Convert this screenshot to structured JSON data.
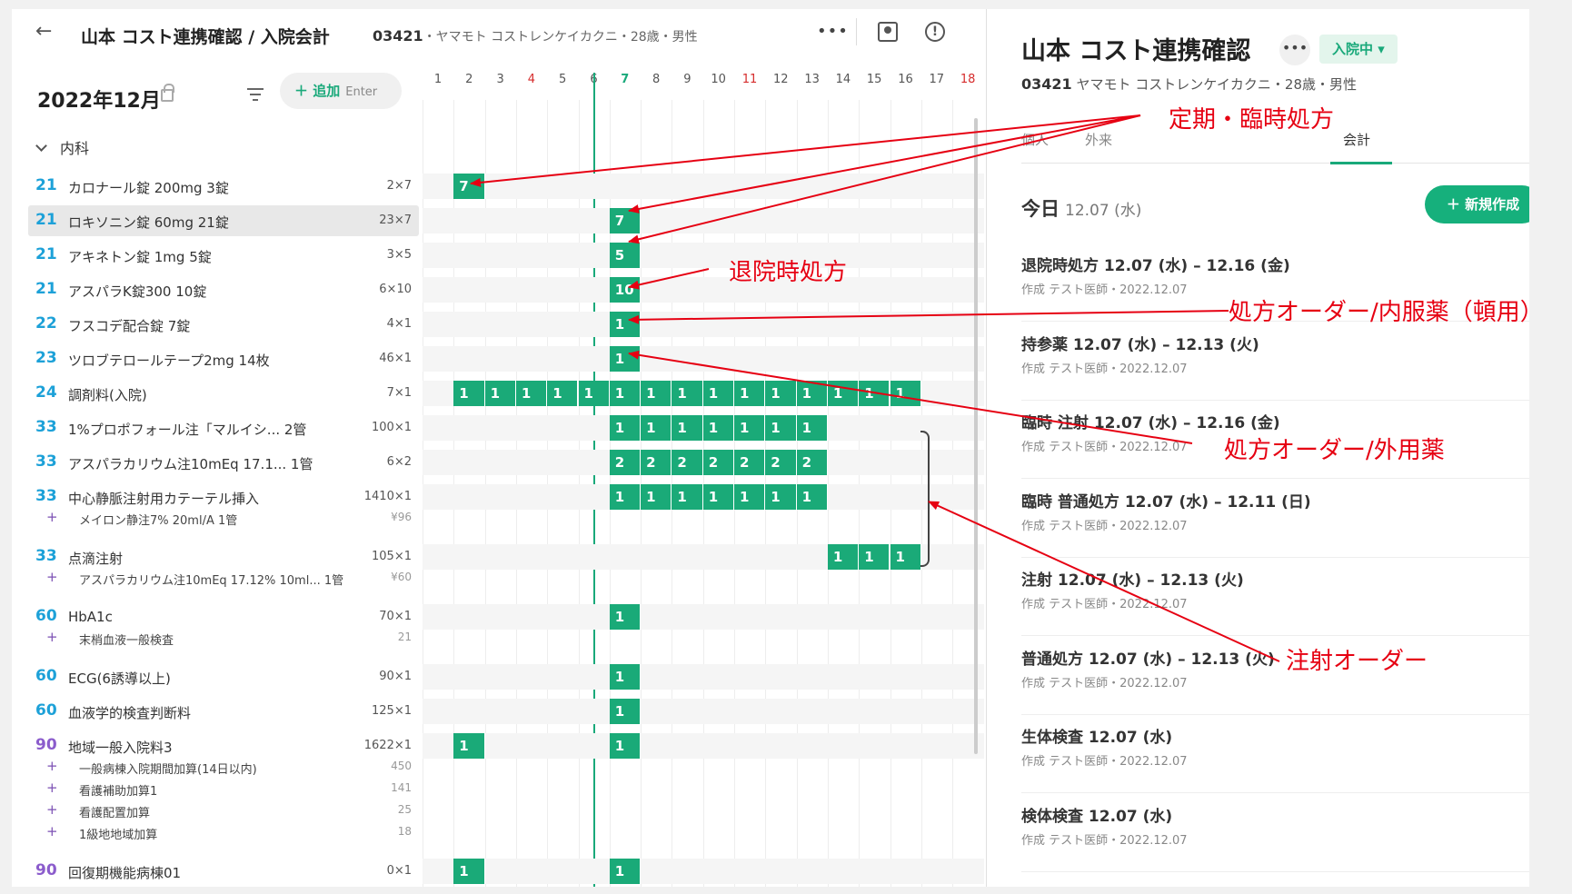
{
  "header": {
    "back_icon": "←",
    "patient_title": "山本 コスト連携確認 / 入院会計",
    "patient_id": "03421",
    "patient_detail": "・ヤマモト コストレンケイカクニ・28歳・男性",
    "more_icon": "•••",
    "alert_icon": "!"
  },
  "toolbar": {
    "month": "2022年12月",
    "add_label": "＋ 追加",
    "add_hint": "Enter"
  },
  "timeline": {
    "days": [
      {
        "d": "1",
        "type": "normal"
      },
      {
        "d": "2",
        "type": "normal"
      },
      {
        "d": "3",
        "type": "normal"
      },
      {
        "d": "4",
        "type": "red"
      },
      {
        "d": "5",
        "type": "normal"
      },
      {
        "d": "6",
        "type": "normal"
      },
      {
        "d": "7",
        "type": "today"
      },
      {
        "d": "8",
        "type": "normal"
      },
      {
        "d": "9",
        "type": "normal"
      },
      {
        "d": "10",
        "type": "normal"
      },
      {
        "d": "11",
        "type": "red"
      },
      {
        "d": "12",
        "type": "normal"
      },
      {
        "d": "13",
        "type": "normal"
      },
      {
        "d": "14",
        "type": "normal"
      },
      {
        "d": "15",
        "type": "normal"
      },
      {
        "d": "16",
        "type": "normal"
      },
      {
        "d": "17",
        "type": "normal"
      },
      {
        "d": "18",
        "type": "red"
      }
    ]
  },
  "section": {
    "label": "内科"
  },
  "rows": [
    {
      "code": "21",
      "color": "blue",
      "name": "カロナール錠 200mg 3錠",
      "qty": "2×7",
      "cells": [
        [
          2,
          "7"
        ]
      ]
    },
    {
      "code": "21",
      "color": "blue",
      "name": "ロキソニン錠 60mg 21錠",
      "qty": "23×7",
      "selected": true,
      "cells": [
        [
          7,
          "7"
        ]
      ]
    },
    {
      "code": "21",
      "color": "blue",
      "name": "アキネトン錠 1mg 5錠",
      "qty": "3×5",
      "cells": [
        [
          7,
          "5"
        ]
      ]
    },
    {
      "code": "21",
      "color": "blue",
      "name": "アスパラK錠300 10錠",
      "qty": "6×10",
      "cells": [
        [
          7,
          "10"
        ]
      ]
    },
    {
      "code": "22",
      "color": "blue",
      "name": "フスコデ配合錠 7錠",
      "qty": "4×1",
      "cells": [
        [
          7,
          "1"
        ]
      ]
    },
    {
      "code": "23",
      "color": "blue",
      "name": "ツロブテロールテープ2mg 14枚",
      "qty": "46×1",
      "cells": [
        [
          7,
          "1"
        ]
      ]
    },
    {
      "code": "24",
      "color": "blue",
      "name": "調剤料(入院)",
      "qty": "7×1",
      "cells": [
        [
          2,
          "1"
        ],
        [
          3,
          "1"
        ],
        [
          4,
          "1"
        ],
        [
          5,
          "1"
        ],
        [
          6,
          "1"
        ],
        [
          7,
          "1"
        ],
        [
          8,
          "1"
        ],
        [
          9,
          "1"
        ],
        [
          10,
          "1"
        ],
        [
          11,
          "1"
        ],
        [
          12,
          "1"
        ],
        [
          13,
          "1"
        ],
        [
          14,
          "1"
        ],
        [
          15,
          "1"
        ],
        [
          16,
          "1"
        ]
      ]
    },
    {
      "code": "33",
      "color": "blue",
      "name": "1%プロポフォール注「マルイシ... 2管",
      "qty": "100×1",
      "cells": [
        [
          7,
          "1"
        ],
        [
          8,
          "1"
        ],
        [
          9,
          "1"
        ],
        [
          10,
          "1"
        ],
        [
          11,
          "1"
        ],
        [
          12,
          "1"
        ],
        [
          13,
          "1"
        ]
      ]
    },
    {
      "code": "33",
      "color": "blue",
      "name": "アスパラカリウム注10mEq 17.1... 1管",
      "qty": "6×2",
      "cells": [
        [
          7,
          "2"
        ],
        [
          8,
          "2"
        ],
        [
          9,
          "2"
        ],
        [
          10,
          "2"
        ],
        [
          11,
          "2"
        ],
        [
          12,
          "2"
        ],
        [
          13,
          "2"
        ]
      ]
    },
    {
      "code": "33",
      "color": "blue",
      "name": "中心静脈注射用カテーテル挿入",
      "qty": "1410×1",
      "cells": [
        [
          7,
          "1"
        ],
        [
          8,
          "1"
        ],
        [
          9,
          "1"
        ],
        [
          10,
          "1"
        ],
        [
          11,
          "1"
        ],
        [
          12,
          "1"
        ],
        [
          13,
          "1"
        ]
      ],
      "subs": [
        {
          "name": "メイロン静注7% 20ml/A 1管",
          "qty": "¥96"
        }
      ]
    },
    {
      "code": "33",
      "color": "blue",
      "name": "点滴注射",
      "qty": "105×1",
      "cells": [
        [
          14,
          "1"
        ],
        [
          15,
          "1"
        ],
        [
          16,
          "1"
        ]
      ],
      "subs": [
        {
          "name": "アスパラカリウム注10mEq 17.12% 10ml... 1管",
          "qty": "¥60"
        }
      ]
    },
    {
      "code": "60",
      "color": "blue",
      "name": "HbA1c",
      "qty": "70×1",
      "cells": [
        [
          7,
          "1"
        ]
      ],
      "subs": [
        {
          "name": "末梢血液一般検査",
          "qty": "21"
        }
      ]
    },
    {
      "code": "60",
      "color": "blue",
      "name": "ECG(6誘導以上)",
      "qty": "90×1",
      "cells": [
        [
          7,
          "1"
        ]
      ]
    },
    {
      "code": "60",
      "color": "blue",
      "name": "血液学的検査判断料",
      "qty": "125×1",
      "cells": [
        [
          7,
          "1"
        ]
      ]
    },
    {
      "code": "90",
      "color": "purple",
      "name": "地域一般入院料3",
      "qty": "1622×1",
      "cells": [
        [
          2,
          "1"
        ],
        [
          7,
          "1"
        ]
      ],
      "subs": [
        {
          "name": "一般病棟入院期間加算(14日以内)",
          "qty": "450"
        },
        {
          "name": "看護補助加算1",
          "qty": "141"
        },
        {
          "name": "看護配置加算",
          "qty": "25"
        },
        {
          "name": "1級地地域加算",
          "qty": "18"
        }
      ]
    },
    {
      "code": "90",
      "color": "purple",
      "name": "回復期機能病棟01",
      "qty": "0×1",
      "cells": [
        [
          2,
          "1"
        ],
        [
          7,
          "1"
        ]
      ]
    }
  ],
  "right": {
    "title": "山本 コスト連携確認",
    "more_icon": "•••",
    "status": "入院中 ▾",
    "info_id": "03421",
    "info_detail": "ヤマモト コストレンケイカクニ・28歳・男性",
    "tabs": [
      "個人",
      "外来",
      "会計"
    ],
    "today_label": "今日",
    "today_date": "12.07 (水)",
    "new_button": "＋ 新規作成",
    "entries": [
      {
        "title": "退院時処方  12.07 (水) – 12.16 (金)",
        "meta": "作成 テスト医師・2022.12.07"
      },
      {
        "title": "持参薬  12.07 (水) – 12.13 (火)",
        "meta": "作成 テスト医師・2022.12.07"
      },
      {
        "title": "臨時 注射  12.07 (水) – 12.16 (金)",
        "meta": "作成 テスト医師・2022.12.07"
      },
      {
        "title": "臨時 普通処方  12.07 (水) – 12.11 (日)",
        "meta": "作成 テスト医師・2022.12.07"
      },
      {
        "title": "注射  12.07 (水) – 12.13 (火)",
        "meta": "作成 テスト医師・2022.12.07"
      },
      {
        "title": "普通処方  12.07 (水) – 12.13 (火)",
        "meta": "作成 テスト医師・2022.12.07"
      },
      {
        "title": "生体検査  12.07 (水)",
        "meta": "作成 テスト医師・2022.12.07"
      },
      {
        "title": "検体検査  12.07 (水)",
        "meta": "作成 テスト医師・2022.12.07"
      }
    ]
  },
  "annotations": {
    "a1": "定期・臨時処方",
    "a2": "退院時処方",
    "a3": "処方オーダー/内服薬（頓用）",
    "a4": "処方オーダー/外用薬",
    "a5": "注射オーダー"
  },
  "colors": {
    "accent": "#1aaa78",
    "code_blue": "#1da1d8",
    "code_purple": "#8b5ccc",
    "annotation": "#e60012",
    "weekend": "#d62c2c"
  }
}
